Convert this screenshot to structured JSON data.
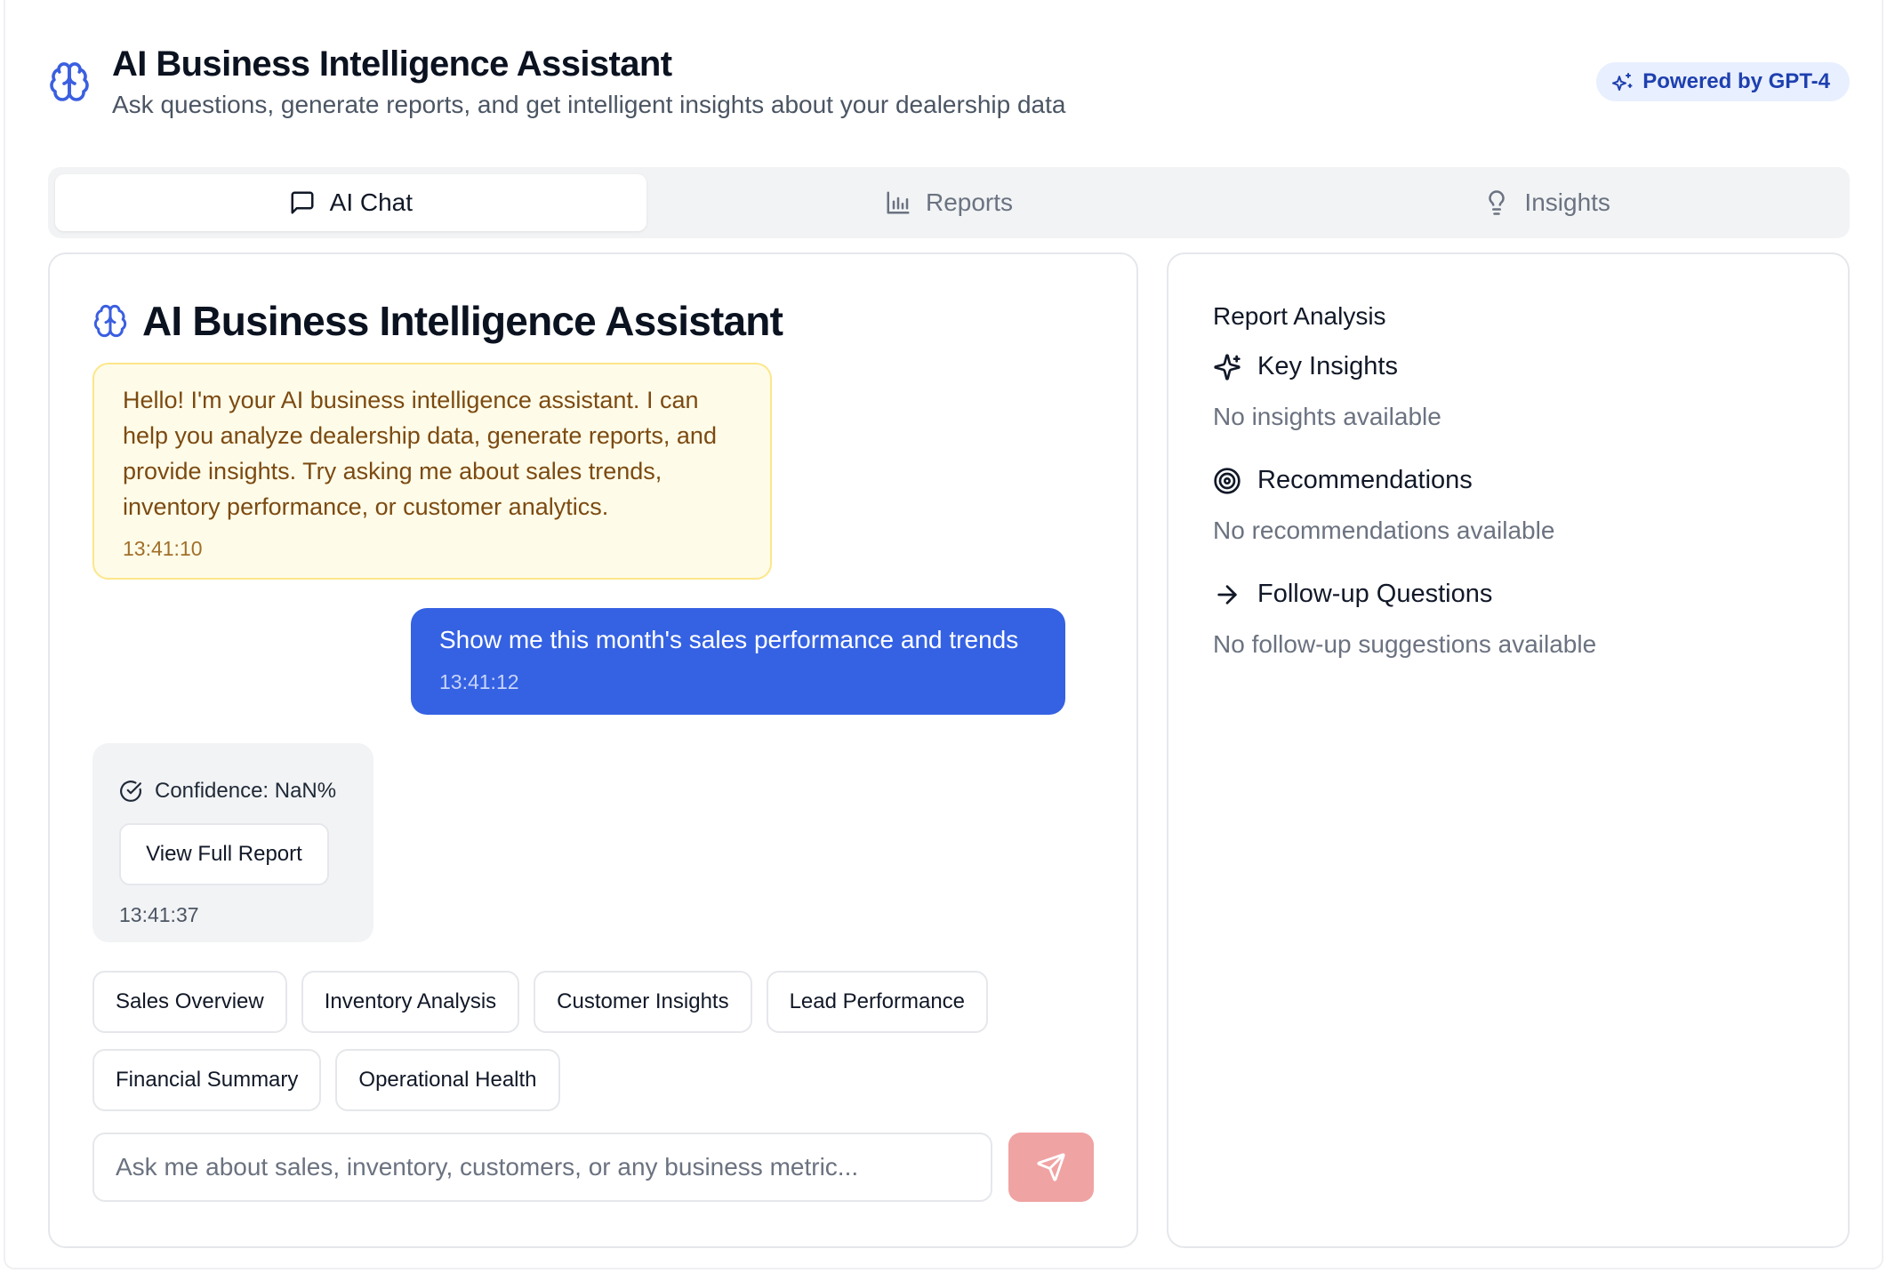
{
  "header": {
    "title": "AI Business Intelligence Assistant",
    "subtitle": "Ask questions, generate reports, and get intelligent insights about your dealership data",
    "badge": "Powered by GPT-4",
    "icon": "brain-icon"
  },
  "tabs": [
    {
      "label": "AI Chat",
      "icon": "message-square-icon",
      "active": true
    },
    {
      "label": "Reports",
      "icon": "bar-chart-icon",
      "active": false
    },
    {
      "label": "Insights",
      "icon": "lightbulb-icon",
      "active": false
    }
  ],
  "chat": {
    "title": "AI Business Intelligence Assistant",
    "messages": [
      {
        "role": "assistant",
        "text": "Hello! I'm your AI business intelligence assistant. I can help you analyze dealership data, generate reports, and provide insights. Try asking me about sales trends, inventory performance, or customer analytics.",
        "time": "13:41:10"
      },
      {
        "role": "user",
        "text": "Show me this month's sales performance and trends",
        "time": "13:41:12"
      },
      {
        "role": "assistant",
        "confidence": "Confidence: NaN%",
        "button": "View Full Report",
        "time": "13:41:37"
      }
    ],
    "quick_actions": [
      "Sales Overview",
      "Inventory Analysis",
      "Customer Insights",
      "Lead Performance",
      "Financial Summary",
      "Operational Health"
    ],
    "input_placeholder": "Ask me about sales, inventory, customers, or any business metric..."
  },
  "analysis": {
    "title": "Report Analysis",
    "sections": [
      {
        "title": "Key Insights",
        "icon": "sparkles-icon",
        "empty": "No insights available"
      },
      {
        "title": "Recommendations",
        "icon": "target-icon",
        "empty": "No recommendations available"
      },
      {
        "title": "Follow-up Questions",
        "icon": "arrow-right-icon",
        "empty": "No follow-up suggestions available"
      }
    ]
  },
  "colors": {
    "accent": "#3562e3",
    "brain_icon": "#3b5fe0",
    "assistant_bubble_bg": "#fefce8",
    "assistant_bubble_border": "#fde68a",
    "send_button": "#f0a3a3",
    "badge_bg": "#e8efff"
  }
}
